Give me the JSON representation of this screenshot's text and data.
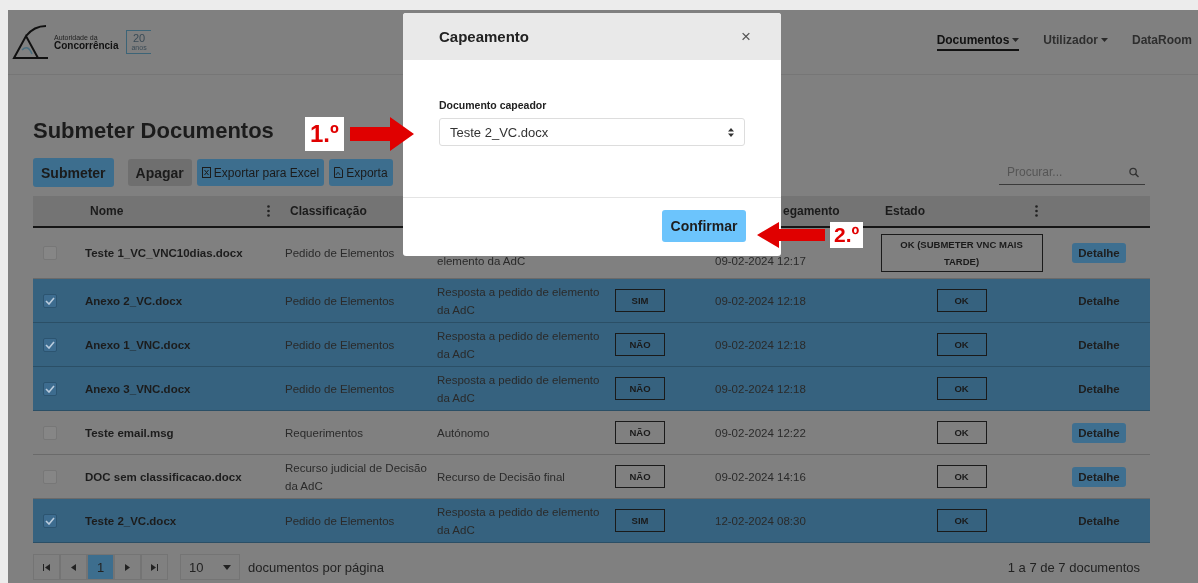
{
  "navbar": {
    "logo": {
      "caption": "Autoridade da",
      "name": "Concorrência",
      "badge": "20",
      "badge_caption": "anos"
    },
    "items": [
      {
        "label": "Documentos",
        "dropdown": true,
        "selected": true
      },
      {
        "label": "Utilizador",
        "dropdown": true,
        "selected": false
      },
      {
        "label": "DataRoom",
        "dropdown": false,
        "selected": false
      }
    ]
  },
  "title": "Submeter Documentos",
  "toolbar": {
    "buttons": [
      {
        "label": "Submeter",
        "kind": "primary"
      },
      {
        "label": "Apagar",
        "kind": "secondary"
      },
      {
        "label": "Exportar para Excel",
        "kind": "excel"
      },
      {
        "label": "Exporta",
        "kind": "pdf"
      }
    ],
    "search": {
      "placeholder": "Procurar..."
    }
  },
  "table": {
    "columns": [
      {
        "label": "Nome",
        "menu": true
      },
      {
        "label": "Classificação",
        "menu": false
      },
      {
        "label": "egamento",
        "menu": false
      },
      {
        "label": "Estado",
        "menu": true
      }
    ],
    "rows": [
      {
        "selected": false,
        "name": "Teste 1_VC_VNC10dias.docx",
        "classification": "Pedido de Elementos",
        "column_4": "elemento da AdC",
        "date": "09-02-2024 12:17",
        "status": "OK (SUBMETER VNC MAIS TARDE)",
        "action": "Detalhe"
      },
      {
        "selected": true,
        "name": "Anexo 2_VC.docx",
        "classification": "Pedido de Elementos",
        "column_4": "Resposta a pedido de elemento da AdC",
        "column_5": "SIM",
        "date": "09-02-2024 12:18",
        "status": "OK",
        "action": "Detalhe"
      },
      {
        "selected": true,
        "name": "Anexo 1_VNC.docx",
        "classification": "Pedido de Elementos",
        "column_4": "Resposta a pedido de elemento da AdC",
        "column_5": "NÃO",
        "date": "09-02-2024 12:18",
        "status": "OK",
        "action": "Detalhe"
      },
      {
        "selected": true,
        "name": "Anexo 3_VNC.docx",
        "classification": "Pedido de Elementos",
        "column_4": "Resposta a pedido de elemento da AdC",
        "column_5": "NÃO",
        "date": "09-02-2024 12:18",
        "status": "OK",
        "action": "Detalhe"
      },
      {
        "selected": false,
        "name": "Teste email.msg",
        "classification": "Requerimentos",
        "column_4": "Autónomo",
        "column_5": "NÃO",
        "date": "09-02-2024 12:22",
        "status": "OK",
        "action": "Detalhe"
      },
      {
        "selected": false,
        "name": "DOC sem classificacao.docx",
        "classification": "Recurso judicial de Decisão da AdC",
        "column_4": "Recurso de Decisão final",
        "column_5": "NÃO",
        "date": "09-02-2024 14:16",
        "status": "OK",
        "action": "Detalhe"
      },
      {
        "selected": true,
        "name": "Teste 2_VC.docx",
        "classification": "Pedido de Elementos",
        "column_4": "Resposta a pedido de elemento da AdC",
        "column_5": "SIM",
        "date": "12-02-2024 08:30",
        "status": "OK",
        "action": "Detalhe"
      }
    ]
  },
  "pagination": {
    "pages": [
      {
        "label": "1",
        "selected": true
      }
    ],
    "page_size": "10",
    "per_page_label": "documentos por página",
    "summary": "1 a 7 de 7 documentos"
  },
  "modal": {
    "title": "Capeamento",
    "close": "×",
    "field_label": "Documento capeador",
    "field_value": "Teste 2_VC.docx",
    "confirm": "Confirmar"
  },
  "annotations": [
    {
      "label": "1.º",
      "kind": "right"
    },
    {
      "label": "2.º",
      "kind": "left"
    }
  ]
}
